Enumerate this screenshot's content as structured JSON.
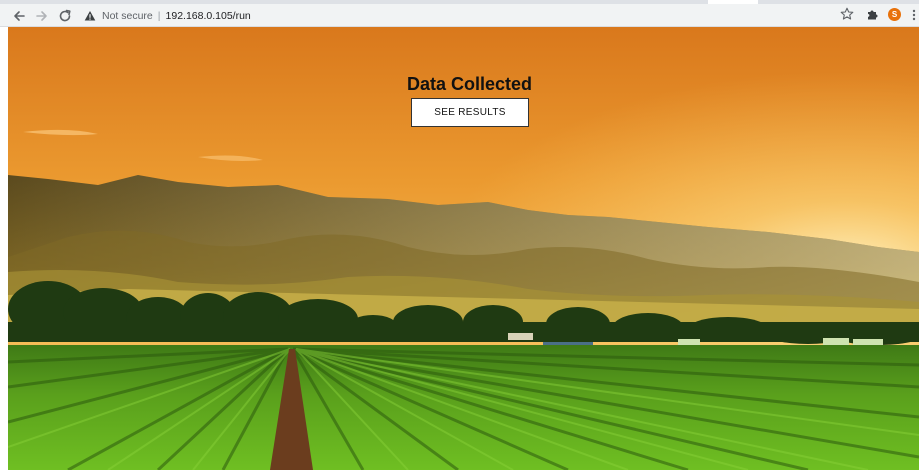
{
  "browser": {
    "security_label": "Not secure",
    "separator": "|",
    "url": "192.168.0.105/run",
    "profile_initial": "S",
    "colors": {
      "toolbar": "#f1f3f4",
      "avatar": "#e8710a"
    },
    "icons": [
      "back-arrow-icon",
      "forward-arrow-icon",
      "reload-icon",
      "warning-icon",
      "star-icon",
      "puzzle-icon",
      "kebab-menu-icon"
    ]
  },
  "page": {
    "title": "Data Collected",
    "button_label": "SEE RESULTS",
    "background": "photo of sunset over hills and green crop field rows",
    "colors": {
      "sky_top": "#e0801a",
      "sky_glow": "#ffd27a",
      "field": "#5aa01c"
    }
  }
}
